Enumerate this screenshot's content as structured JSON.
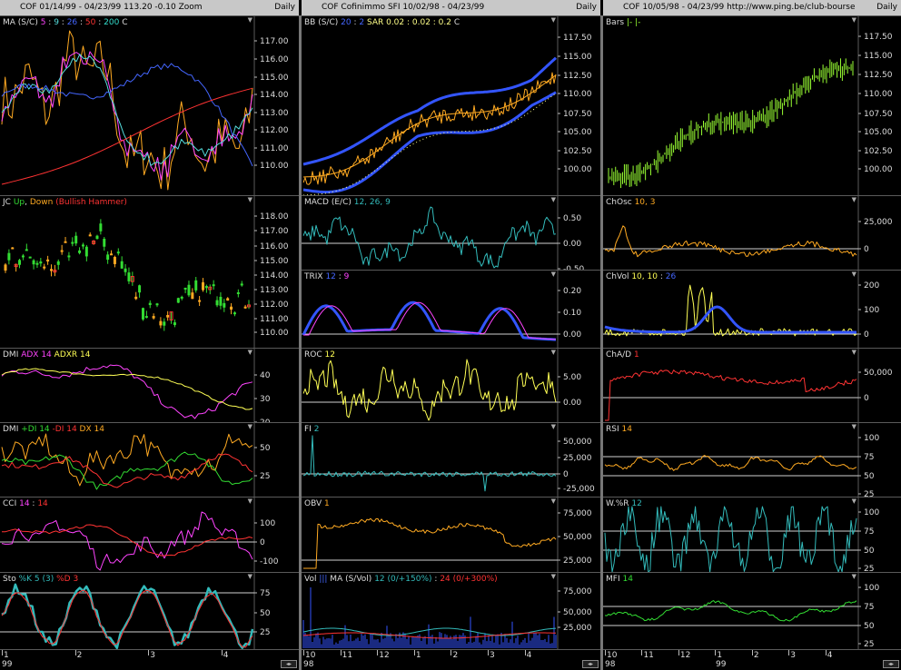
{
  "columns": [
    {
      "header": {
        "title": "COF  01/14/99 - 04/23/99   113.20  -0.10   Zoom",
        "period": "Daily"
      },
      "xaxis": {
        "labels": [
          "1",
          "2",
          "3",
          "4"
        ],
        "year": "99"
      },
      "panels": [
        {
          "label_parts": [
            {
              "text": "MA (S/C) ",
              "color": "#dddddd"
            },
            {
              "text": "5",
              "color": "#ff44ff"
            },
            {
              "text": " : ",
              "color": "#dddddd"
            },
            {
              "text": "9",
              "color": "#55dddd"
            },
            {
              "text": " : ",
              "color": "#dddddd"
            },
            {
              "text": "26",
              "color": "#4466ff"
            },
            {
              "text": " : ",
              "color": "#dddddd"
            },
            {
              "text": "50",
              "color": "#ff3333"
            },
            {
              "text": " : ",
              "color": "#dddddd"
            },
            {
              "text": "200",
              "color": "#33ddcc"
            },
            {
              "text": "    C",
              "color": "#dddddd"
            }
          ],
          "ticks": [
            "117.00",
            "116.00",
            "115.00",
            "114.00",
            "113.00",
            "112.00",
            "111.00",
            "110.00"
          ]
        },
        {
          "label_parts": [
            {
              "text": "JC ",
              "color": "#dddddd"
            },
            {
              "text": "Up",
              "color": "#33dd33"
            },
            {
              "text": ", ",
              "color": "#dddddd"
            },
            {
              "text": "Down",
              "color": "#ffaa22"
            },
            {
              "text": "  (Bullish Hammer)",
              "color": "#ff3333"
            }
          ],
          "ticks": [
            "118.00",
            "117.00",
            "116.00",
            "115.00",
            "114.00",
            "113.00",
            "112.00",
            "111.00",
            "110.00"
          ]
        },
        {
          "label_parts": [
            {
              "text": "DMI  ",
              "color": "#dddddd"
            },
            {
              "text": "ADX 14",
              "color": "#ff44ff"
            },
            {
              "text": "  ADXR 14",
              "color": "#ffff55"
            }
          ],
          "ticks": [
            "40",
            "30",
            "20"
          ]
        },
        {
          "label_parts": [
            {
              "text": "DMI  ",
              "color": "#dddddd"
            },
            {
              "text": "+DI 14",
              "color": "#33dd33"
            },
            {
              "text": "  -DI 14",
              "color": "#ff3333"
            },
            {
              "text": "  DX 14",
              "color": "#ffaa22"
            }
          ],
          "ticks": [
            "50",
            "25"
          ]
        },
        {
          "label_parts": [
            {
              "text": "CCI  ",
              "color": "#dddddd"
            },
            {
              "text": "14",
              "color": "#ff44ff"
            },
            {
              "text": " : ",
              "color": "#dddddd"
            },
            {
              "text": "14",
              "color": "#ff3333"
            }
          ],
          "ticks": [
            "100",
            "0",
            "-100"
          ]
        },
        {
          "label_parts": [
            {
              "text": "Sto  ",
              "color": "#dddddd"
            },
            {
              "text": "%K 5 (3)",
              "color": "#33bbbb"
            },
            {
              "text": "  %D 3",
              "color": "#ff3333"
            }
          ],
          "ticks": [
            "75",
            "50",
            "25"
          ]
        }
      ]
    },
    {
      "header": {
        "title": "COF   Cofinimmo SFI   10/02/98 - 04/23/99",
        "period": "Daily"
      },
      "xaxis": {
        "labels": [
          "10",
          "11",
          "12",
          "1",
          "2",
          "3",
          "4"
        ],
        "year": "98"
      },
      "panels": [
        {
          "label_parts": [
            {
              "text": "BB (S/C)  ",
              "color": "#dddddd"
            },
            {
              "text": "20",
              "color": "#4466ff"
            },
            {
              "text": " : ",
              "color": "#dddddd"
            },
            {
              "text": "2",
              "color": "#4466ff"
            },
            {
              "text": "    SAR  0.02 : 0.02 : 0.2",
              "color": "#ffff88"
            },
            {
              "text": "    C",
              "color": "#dddddd"
            }
          ],
          "ticks": [
            "117.50",
            "115.00",
            "112.50",
            "110.00",
            "107.50",
            "105.00",
            "102.50",
            "100.00"
          ]
        },
        {
          "label_parts": [
            {
              "text": "MACD (E/C)  ",
              "color": "#dddddd"
            },
            {
              "text": "12, 26, 9",
              "color": "#33bbbb"
            }
          ],
          "ticks": [
            "0.50",
            "0.00",
            "-0.50"
          ]
        },
        {
          "label_parts": [
            {
              "text": "TRIX  ",
              "color": "#dddddd"
            },
            {
              "text": "12",
              "color": "#4466ff"
            },
            {
              "text": " : ",
              "color": "#dddddd"
            },
            {
              "text": "9",
              "color": "#ff44ff"
            }
          ],
          "ticks": [
            "0.20",
            "0.10",
            "0.00"
          ]
        },
        {
          "label_parts": [
            {
              "text": "ROC  ",
              "color": "#dddddd"
            },
            {
              "text": "12",
              "color": "#ffff55"
            }
          ],
          "ticks": [
            "5.00",
            "0.00"
          ]
        },
        {
          "label_parts": [
            {
              "text": "FI  ",
              "color": "#dddddd"
            },
            {
              "text": "2",
              "color": "#33bbbb"
            }
          ],
          "ticks": [
            "50,000",
            "25,000",
            "0",
            "-25,000"
          ]
        },
        {
          "label_parts": [
            {
              "text": "OBV  ",
              "color": "#dddddd"
            },
            {
              "text": "1",
              "color": "#ffaa22"
            }
          ],
          "ticks": [
            "75,000",
            "50,000",
            "25,000",
            "0"
          ]
        },
        {
          "label_parts": [
            {
              "text": "Vol ",
              "color": "#dddddd"
            },
            {
              "text": "|||",
              "color": "#4466ff"
            },
            {
              "text": "   MA (S/Vol)  ",
              "color": "#dddddd"
            },
            {
              "text": "12 (0/+150%)",
              "color": "#33bbbb"
            },
            {
              "text": " : ",
              "color": "#dddddd"
            },
            {
              "text": "24 (0/+300%)",
              "color": "#ff3333"
            }
          ],
          "ticks": [
            "75,000",
            "50,000",
            "25,000"
          ]
        }
      ]
    },
    {
      "header": {
        "title": "COF   10/05/98 - 04/23/99     http://www.ping.be/club-bourse",
        "period": "Daily"
      },
      "xaxis": {
        "labels": [
          "10",
          "11",
          "12",
          "1",
          "2",
          "3",
          "4"
        ],
        "year": "98",
        "year2": "99"
      },
      "panels": [
        {
          "label_parts": [
            {
              "text": "Bars  ",
              "color": "#dddddd"
            },
            {
              "text": "|-  |-",
              "color": "#99ff33"
            }
          ],
          "ticks": [
            "117.50",
            "115.00",
            "112.50",
            "110.00",
            "107.50",
            "105.00",
            "102.50",
            "100.00"
          ]
        },
        {
          "label_parts": [
            {
              "text": "ChOsc  ",
              "color": "#dddddd"
            },
            {
              "text": "10, 3",
              "color": "#ffaa22"
            }
          ],
          "ticks": [
            "25,000",
            "0"
          ]
        },
        {
          "label_parts": [
            {
              "text": "ChVol  ",
              "color": "#dddddd"
            },
            {
              "text": "10, 10",
              "color": "#ffff55"
            },
            {
              "text": " : ",
              "color": "#dddddd"
            },
            {
              "text": "26",
              "color": "#4466ff"
            }
          ],
          "ticks": [
            "200",
            "100",
            "0"
          ]
        },
        {
          "label_parts": [
            {
              "text": "ChA/D  ",
              "color": "#dddddd"
            },
            {
              "text": "1",
              "color": "#ff3333"
            }
          ],
          "ticks": [
            "50,000",
            "0"
          ]
        },
        {
          "label_parts": [
            {
              "text": "RSI  ",
              "color": "#dddddd"
            },
            {
              "text": "14",
              "color": "#ffaa22"
            }
          ],
          "ticks": [
            "100",
            "75",
            "50",
            "25"
          ]
        },
        {
          "label_parts": [
            {
              "text": "W.%R  ",
              "color": "#dddddd"
            },
            {
              "text": "12",
              "color": "#33bbbb"
            }
          ],
          "ticks": [
            "100",
            "75",
            "50",
            "25"
          ]
        },
        {
          "label_parts": [
            {
              "text": "MFI  ",
              "color": "#dddddd"
            },
            {
              "text": "14",
              "color": "#33dd33"
            }
          ],
          "ticks": [
            "100",
            "75",
            "50",
            "25"
          ]
        }
      ]
    }
  ]
}
